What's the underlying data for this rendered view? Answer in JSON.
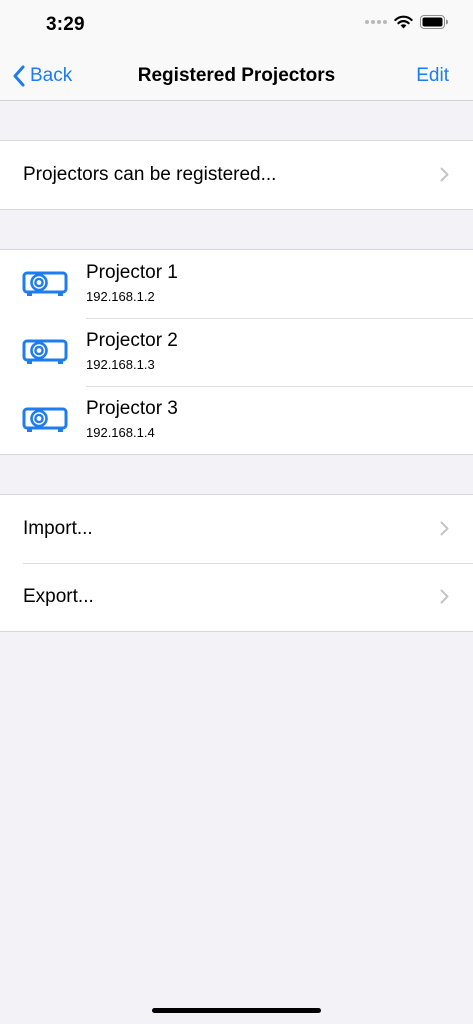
{
  "status": {
    "time": "3:29"
  },
  "nav": {
    "back_label": "Back",
    "title": "Registered Projectors",
    "edit_label": "Edit"
  },
  "info_row": {
    "label": "Projectors can be registered..."
  },
  "projectors": [
    {
      "name": "Projector 1",
      "ip": "192.168.1.2"
    },
    {
      "name": "Projector 2",
      "ip": "192.168.1.3"
    },
    {
      "name": "Projector 3",
      "ip": "192.168.1.4"
    }
  ],
  "actions": {
    "import_label": "Import...",
    "export_label": "Export..."
  },
  "colors": {
    "accent": "#1c7cf0",
    "background": "#f2f2f7",
    "chevron": "#c4c4c7"
  },
  "icons": {
    "projector": "projector-icon",
    "chevron": "chevron-right-icon",
    "back": "chevron-left-icon"
  }
}
